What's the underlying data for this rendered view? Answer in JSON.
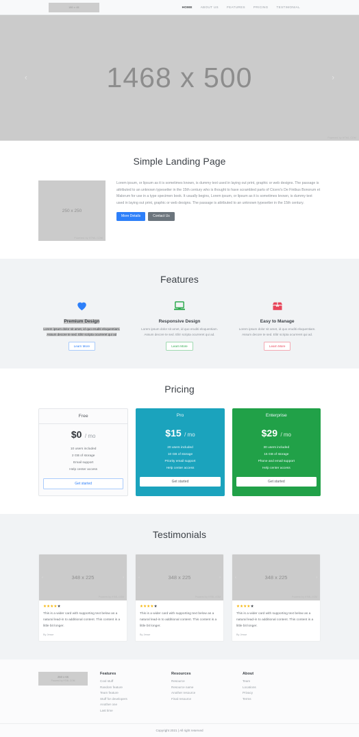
{
  "nav": {
    "logo_placeholder": "180 x 45",
    "links": [
      {
        "label": "HOME",
        "active": true
      },
      {
        "label": "ABOUT US",
        "active": false
      },
      {
        "label": "FEATURES",
        "active": false
      },
      {
        "label": "PRICING",
        "active": false
      },
      {
        "label": "TESTIMONIAL",
        "active": false
      }
    ]
  },
  "hero": {
    "placeholder": "1468 x 500",
    "prev_icon": "‹",
    "next_icon": "›",
    "watermark": "Powered by HTML.COM"
  },
  "about": {
    "title": "Simple Landing Page",
    "image_placeholder": "250 x 250",
    "image_watermark": "Powered by HTML.COM",
    "paragraph": "Lorem ipsum, or lipsum as it is sometimes known, is dummy text used in laying out print, graphic or web designs. The passage is attributed to an unknown typesetter in the 15th century who is thought to have scrambled parts of Cicero's De Finibus Bonorum et Malorum for use in a type specimen book. It usually begins, Lorem ipsum, or lipsum as it is sometimes known, is dummy text used in laying out print, graphic or web designs. The passage is attributed to an unknown typesetter in the 15th century.",
    "primary_button": "More Details",
    "secondary_button": "Contact Us"
  },
  "features": {
    "title": "Features",
    "items": [
      {
        "icon": "heart-icon",
        "color": "#2d7ff9",
        "title": "Premium Design",
        "desc": "Lorem ipsum dolor sit amet, id quo eruditi eloquentiam. Assum decore te sed. Elitr scripta ocurreret qui ad",
        "button": "Learn More",
        "selected": true
      },
      {
        "icon": "monitor-icon",
        "color": "#2faa4f",
        "title": "Responsive Design",
        "desc": "Lorem ipsum dolor sit amet, id quo eruditi eloquentiam. Assum decore te sed. Elitr scripta ocurreret qui ad.",
        "button": "Learn More",
        "selected": false
      },
      {
        "icon": "open-box-icon",
        "color": "#e8455a",
        "title": "Easy to Manage",
        "desc": "Lorem ipsum dolor sit amet, id quo eruditi eloquentiam. Assum decore te sed. Elitr scripta ocurreret qui ad.",
        "button": "Learn More",
        "selected": false
      }
    ]
  },
  "pricing": {
    "title": "Pricing",
    "plans": [
      {
        "name": "Free",
        "amount": "$0",
        "period": "/ mo",
        "features": [
          "10 users included",
          "2 GB of storage",
          "Email support",
          "Help center access"
        ],
        "button": "Get started",
        "accent": "#ffffff"
      },
      {
        "name": "Pro",
        "amount": "$15",
        "period": "/ mo",
        "features": [
          "20 users included",
          "10 GB of storage",
          "Priority email support",
          "Help center access"
        ],
        "button": "Get started",
        "accent": "#1ba3bd"
      },
      {
        "name": "Enterprise",
        "amount": "$29",
        "period": "/ mo",
        "features": [
          "30 users included",
          "15 GB of storage",
          "Phone and email support",
          "Help center access"
        ],
        "button": "Get started",
        "accent": "#21a148"
      }
    ]
  },
  "testimonials": {
    "title": "Testimonials",
    "items": [
      {
        "image_placeholder": "348 x 225",
        "watermark": "Powered by HTML.COM",
        "stars_filled": 4,
        "stars_total": 5,
        "text": "This is a wider card with supporting text below as a natural lead-in to additional content. This content is a little bit longer.",
        "author": "By Jesse"
      },
      {
        "image_placeholder": "348 x 225",
        "watermark": "Powered by HTML.COM",
        "stars_filled": 4,
        "stars_total": 5,
        "text": "This is a wider card with supporting text below as a natural lead-in to additional content. This content is a little bit longer.",
        "author": "By Jesse"
      },
      {
        "image_placeholder": "348 x 225",
        "watermark": "Powered by HTML.COM",
        "stars_filled": 4,
        "stars_total": 5,
        "text": "This is a wider card with supporting text below as a natural lead-in to additional content. This content is a little bit longer.",
        "author": "By Jesse"
      }
    ]
  },
  "footer": {
    "logo_placeholder": "250 x 65",
    "logo_watermark": "Powered by HTML.COM",
    "columns": [
      {
        "heading": "Features",
        "links": [
          "Cool stuff",
          "Random feature",
          "Team feature",
          "Stuff for developers",
          "Another one",
          "Last time"
        ]
      },
      {
        "heading": "Resources",
        "links": [
          "Resource",
          "Resource name",
          "Another resource",
          "Final resource"
        ]
      },
      {
        "heading": "About",
        "links": [
          "Team",
          "Locations",
          "Privacy",
          "Terms"
        ]
      }
    ],
    "copyright": "Copyright 2021 | All right reserved"
  }
}
